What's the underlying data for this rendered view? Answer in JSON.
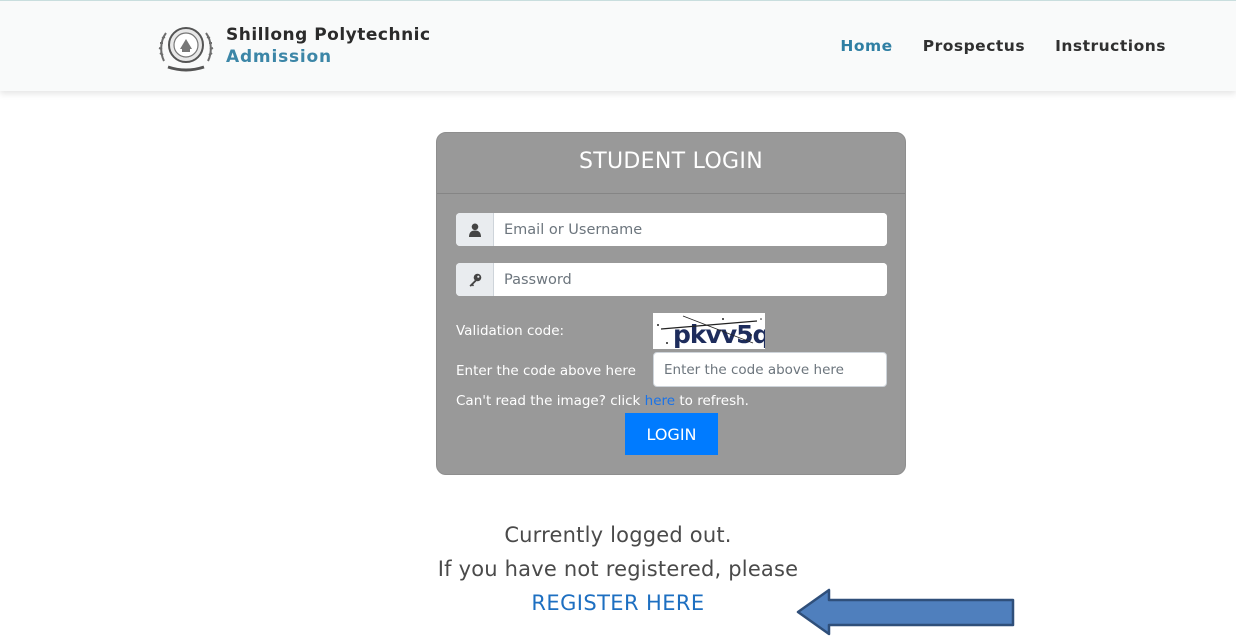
{
  "header": {
    "brand_title": "Shillong Polytechnic",
    "brand_subtitle": "Admission",
    "logo_icon": "college-crest-icon",
    "nav": [
      {
        "label": "Home",
        "active": true
      },
      {
        "label": "Prospectus",
        "active": false
      },
      {
        "label": "Instructions",
        "active": false
      }
    ]
  },
  "login": {
    "title": "STUDENT LOGIN",
    "username_placeholder": "Email or Username",
    "username_value": "",
    "username_icon": "user-icon",
    "password_placeholder": "Password",
    "password_value": "",
    "password_icon": "key-icon",
    "validation_label": "Validation code:",
    "captcha_text": "pkvv5q",
    "code_label": "Enter the code above here",
    "code_placeholder": "Enter the code above here",
    "code_value": "",
    "refresh_prefix": "Can't read the image? click ",
    "refresh_link": "here",
    "refresh_suffix": " to refresh.",
    "login_button": "LOGIN"
  },
  "status": {
    "line1": "Currently logged out.",
    "line2": "If you have not registered, please",
    "register_link": "REGISTER HERE",
    "arrow_icon": "left-arrow-annotation-icon"
  },
  "colors": {
    "accent": "#3c86a7",
    "card_bg": "#999999",
    "button": "#007bff",
    "link": "#1d6fc1",
    "arrow_fill": "#4f7fbd",
    "arrow_stroke": "#2f4f7a"
  }
}
